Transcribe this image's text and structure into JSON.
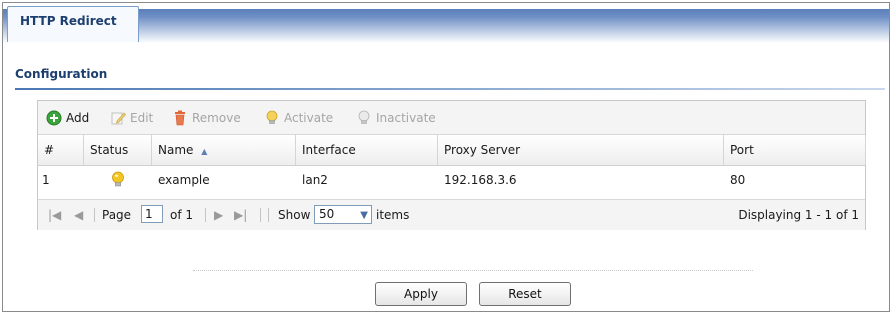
{
  "tab": {
    "label": "HTTP Redirect"
  },
  "section": {
    "title": "Configuration"
  },
  "toolbar": {
    "add": "Add",
    "edit": "Edit",
    "remove": "Remove",
    "activate": "Activate",
    "inactivate": "Inactivate"
  },
  "table": {
    "headers": [
      "#",
      "Status",
      "Name",
      "Interface",
      "Proxy Server",
      "Port"
    ],
    "sort_indicator": "▲",
    "rows": [
      {
        "index": "1",
        "status_icon": "bulb-on-icon",
        "name": "example",
        "interface": "lan2",
        "proxy_server": "192.168.3.6",
        "port": "80"
      }
    ]
  },
  "pager": {
    "page_label": "Page",
    "page_value": "1",
    "of_label": "of 1",
    "show_label": "Show",
    "show_value": "50",
    "items_label": "items",
    "displaying": "Displaying 1 - 1 of 1"
  },
  "buttons": {
    "apply": "Apply",
    "reset": "Reset"
  },
  "colors": {
    "accent": "#1d3f6f",
    "add_icon": "#3aa53a",
    "remove_icon": "#e0683a",
    "bulb": "#f3c623"
  }
}
